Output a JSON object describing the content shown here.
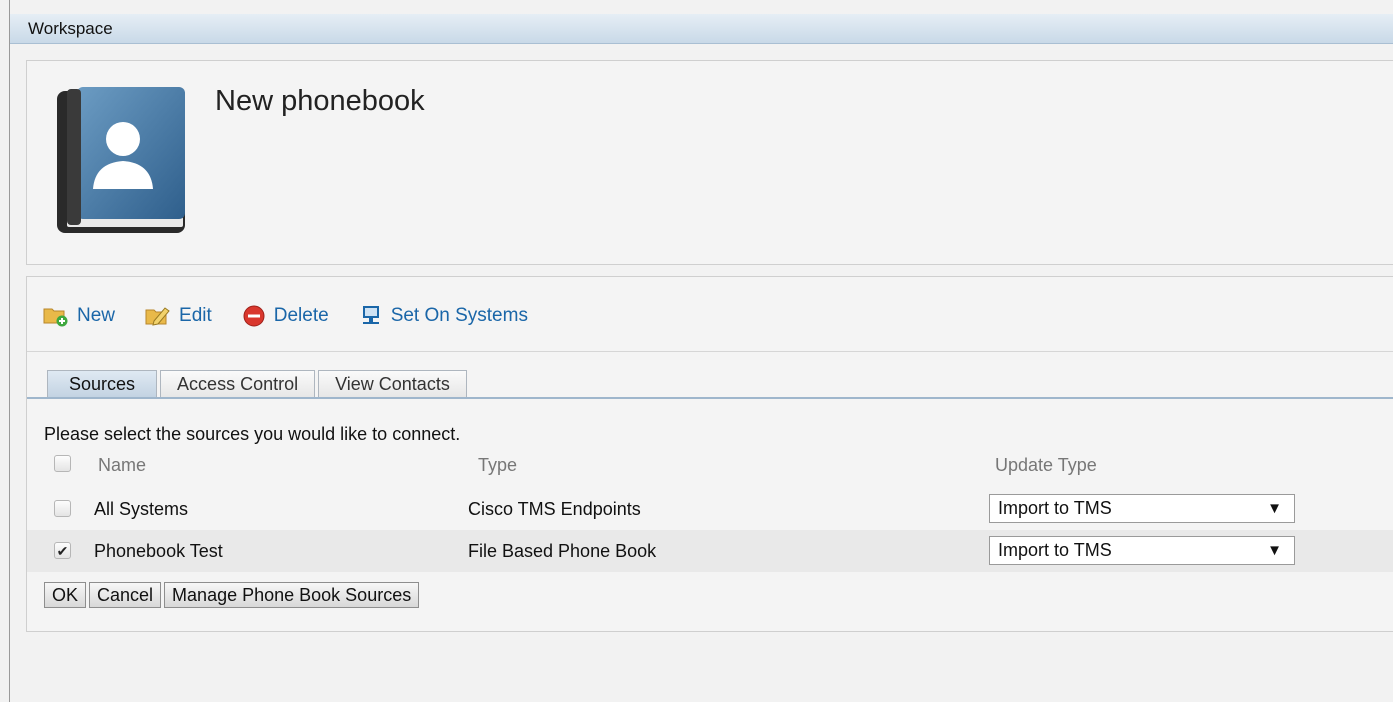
{
  "header": {
    "title": "Workspace"
  },
  "phonebook": {
    "title": "New phonebook"
  },
  "toolbar": {
    "new_label": "New",
    "edit_label": "Edit",
    "delete_label": "Delete",
    "set_on_systems_label": "Set On Systems"
  },
  "tabs": [
    {
      "label": "Sources",
      "active": true
    },
    {
      "label": "Access Control",
      "active": false
    },
    {
      "label": "View Contacts",
      "active": false
    }
  ],
  "sources": {
    "prompt": "Please select the sources you would like to connect.",
    "columns": {
      "name": "Name",
      "type": "Type",
      "update_type": "Update Type"
    },
    "rows": [
      {
        "name": "All Systems",
        "type": "Cisco TMS Endpoints",
        "update_type": "Import to TMS",
        "checked": false
      },
      {
        "name": "Phonebook Test",
        "type": "File Based Phone Book",
        "update_type": "Import to TMS",
        "checked": true
      }
    ]
  },
  "buttons": {
    "ok": "OK",
    "cancel": "Cancel",
    "manage": "Manage Phone Book Sources"
  },
  "icons": {
    "new": "folder-add-icon",
    "edit": "folder-edit-icon",
    "delete": "delete-icon",
    "set_on_systems": "monitor-icon",
    "phonebook": "phonebook-book-icon"
  },
  "colors": {
    "link": "#1a66a8",
    "header": "#c9d9e8",
    "delete": "#d9372d"
  }
}
